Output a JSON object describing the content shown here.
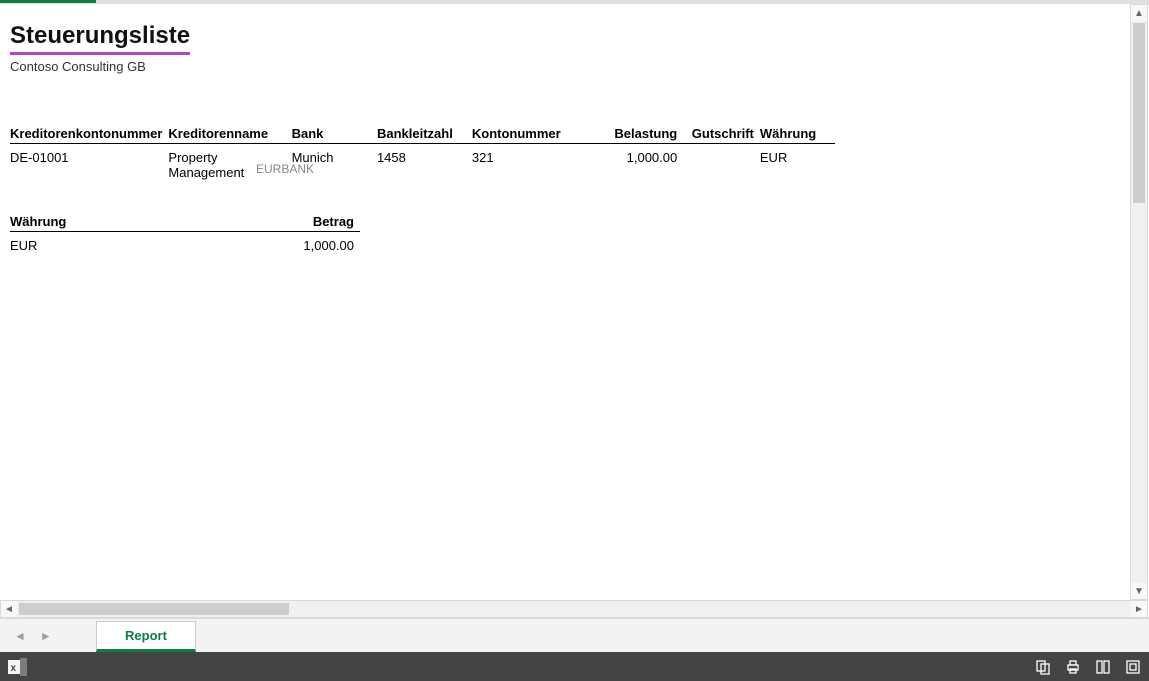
{
  "report": {
    "title": "Steuerungsliste",
    "subtitle": "Contoso Consulting GB",
    "bank_peek": "EURBANK"
  },
  "table_main": {
    "headers": {
      "creditor_account_no": "Kreditorenkontonummer",
      "creditor_name": "Kreditorenname",
      "bank": "Bank",
      "bank_code": "Bankleitzahl",
      "account_no": "Kontonummer",
      "debit": "Belastung",
      "credit": "Gutschrift",
      "currency": "Währung"
    },
    "rows": [
      {
        "creditor_account_no": "DE-01001",
        "creditor_name": "Property Management",
        "bank": "Munich",
        "bank_code": "1458",
        "account_no": "321",
        "debit": "1,000.00",
        "credit": "",
        "currency": "EUR"
      }
    ]
  },
  "table_summary": {
    "headers": {
      "currency": "Währung",
      "amount": "Betrag"
    },
    "rows": [
      {
        "currency": "EUR",
        "amount": "1,000.00"
      }
    ]
  },
  "sheet_tab": {
    "label": "Report"
  }
}
